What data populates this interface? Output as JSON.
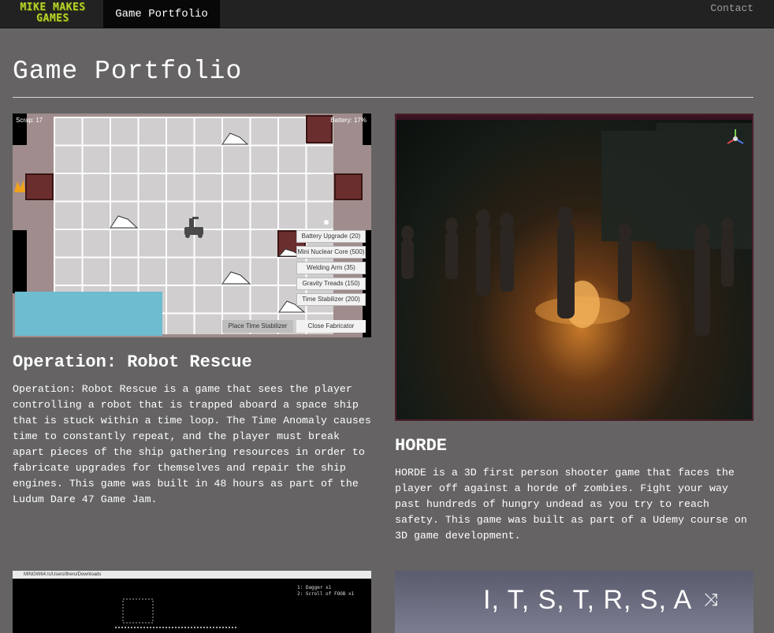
{
  "nav": {
    "brand_line1": "MIKE MAKES",
    "brand_line2": "GAMES",
    "active_tab": "Game Portfolio",
    "contact": "Contact"
  },
  "page": {
    "title": "Game Portfolio"
  },
  "projects": [
    {
      "title": "Operation: Robot Rescue",
      "description": "Operation: Robot Rescue is a game that sees the player controlling a robot that is trapped aboard a space ship that is stuck within a time loop. The Time Anomaly causes time to constantly repeat, and the player must break apart pieces of the ship gathering resources in order to fabricate upgrades for themselves and repair the ship engines. This game was built in 48 hours as part of the Ludum Dare 47 Game Jam.",
      "screenshot": {
        "scrap": "Scrap: 17",
        "battery": "Battery: 17%",
        "upgrades": [
          "Battery Upgrade (20)",
          "Mini Nuclear Core (500)",
          "Welding Arm (35)",
          "Gravity Treads (150)",
          "Time Stabilizer (200)"
        ],
        "place_button": "Place Time Stabilizer",
        "close_button": "Close Fabricator"
      }
    },
    {
      "title": "HORDE",
      "description": "HORDE is a 3D first person shooter game that faces the player off against a horde of zombies. Fight your way past hundreds of hungry undead as you try to reach safety. This game was built as part of a Udemy course on 3D game development."
    },
    {
      "screenshot": {
        "window_title": "MINGW64:/c/Users/theru/Downloads",
        "line1": "1: Dagger x1",
        "line2": "2: Scroll of FOOB x1"
      }
    },
    {
      "screenshot": {
        "letters": "I, T, S, T, R, S, A"
      }
    }
  ]
}
